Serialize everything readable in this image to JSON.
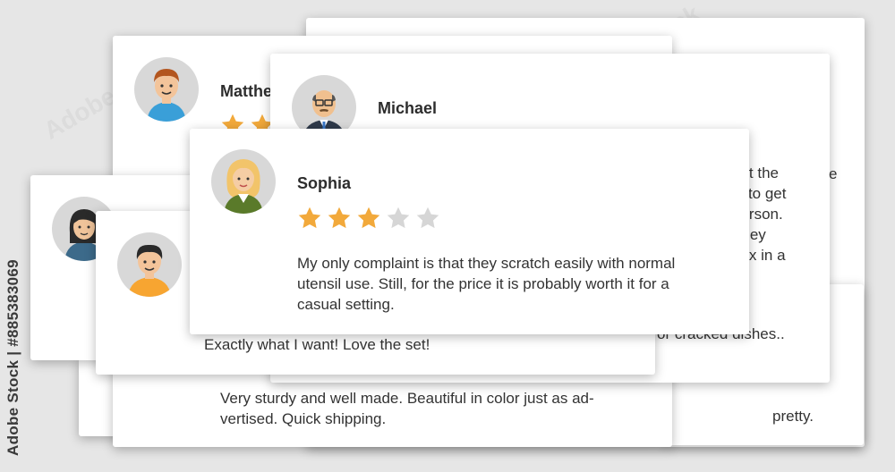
{
  "credit": "Adobe Stock | #885383069",
  "watermark_text": "Adobe Stock",
  "star_colors": {
    "filled": "#f2a93b",
    "empty": "#d6d6d6"
  },
  "reviews": {
    "sophia": {
      "name": "Sophia",
      "rating": 3,
      "max_rating": 5,
      "text_lines": [
        "My only complaint is that they scratch easily with normal",
        "utensil use. Still, for the price it is probably worth it for a",
        "casual setting."
      ]
    },
    "michael": {
      "name": "Michael"
    },
    "matthew": {
      "name_visible": "Matthe"
    },
    "boy_review": {
      "text": "Exactly what I want! Love the set!"
    },
    "bottom_review": {
      "text_lines": [
        "Very sturdy and well made. Beautiful in color just as ad-",
        "vertised. Quick shipping."
      ]
    },
    "partial_right": {
      "lines": [
        "e",
        "t at the",
        "le to get",
        "person.",
        "They",
        "box in a"
      ],
      "cracked": "or cracked dishes..",
      "pretty": "pretty."
    }
  }
}
